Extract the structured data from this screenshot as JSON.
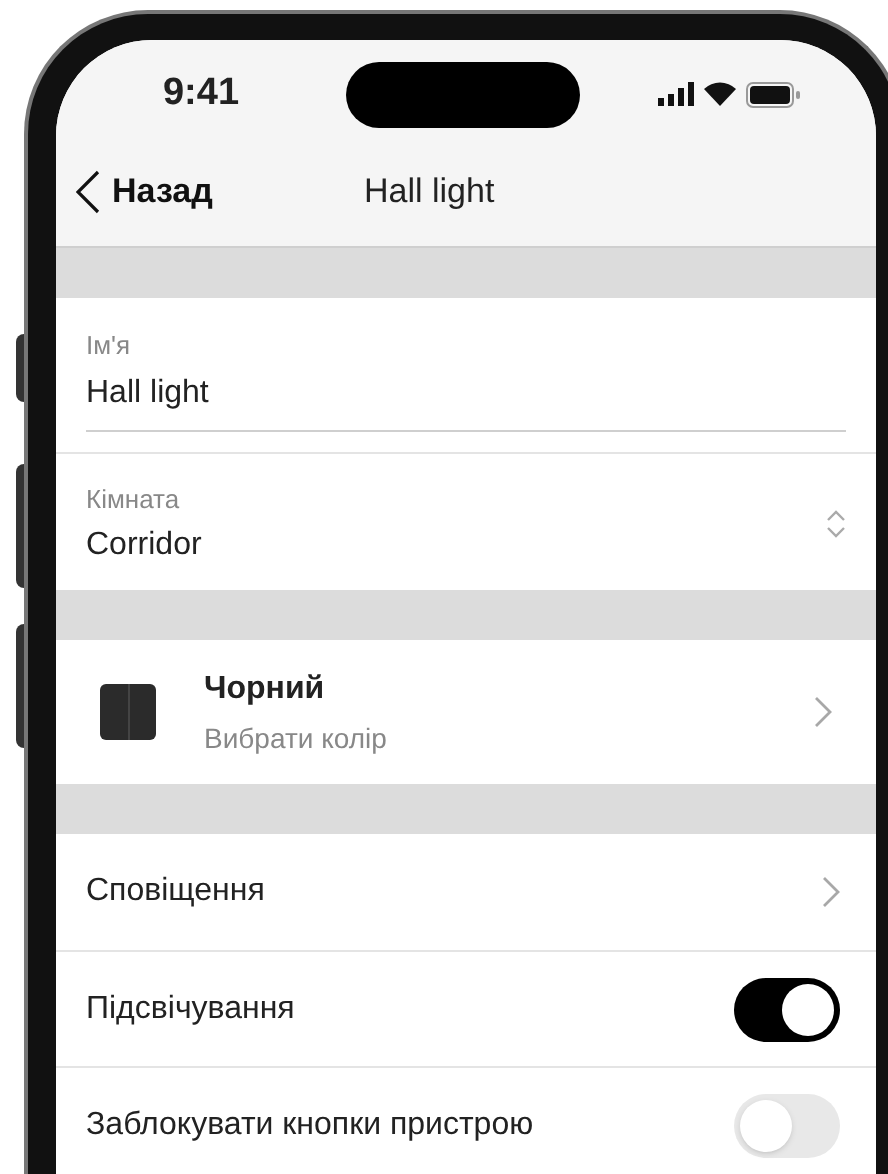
{
  "status_bar": {
    "time": "9:41"
  },
  "nav": {
    "back": "Назад",
    "title": "Hall light"
  },
  "fields": [
    {
      "label": "Ім'я",
      "value": "Hall light",
      "kind": "text"
    },
    {
      "label": "Кімната",
      "value": "Corridor",
      "kind": "select"
    }
  ],
  "color_row": {
    "title": "Чорний",
    "subtitle": "Вибрати колір"
  },
  "settings": [
    {
      "label": "Сповіщення",
      "kind": "link"
    },
    {
      "label": "Підсвічування",
      "kind": "toggle",
      "on": true
    },
    {
      "label": "Заблокувати кнопки пристрою",
      "kind": "toggle",
      "on": false
    }
  ]
}
